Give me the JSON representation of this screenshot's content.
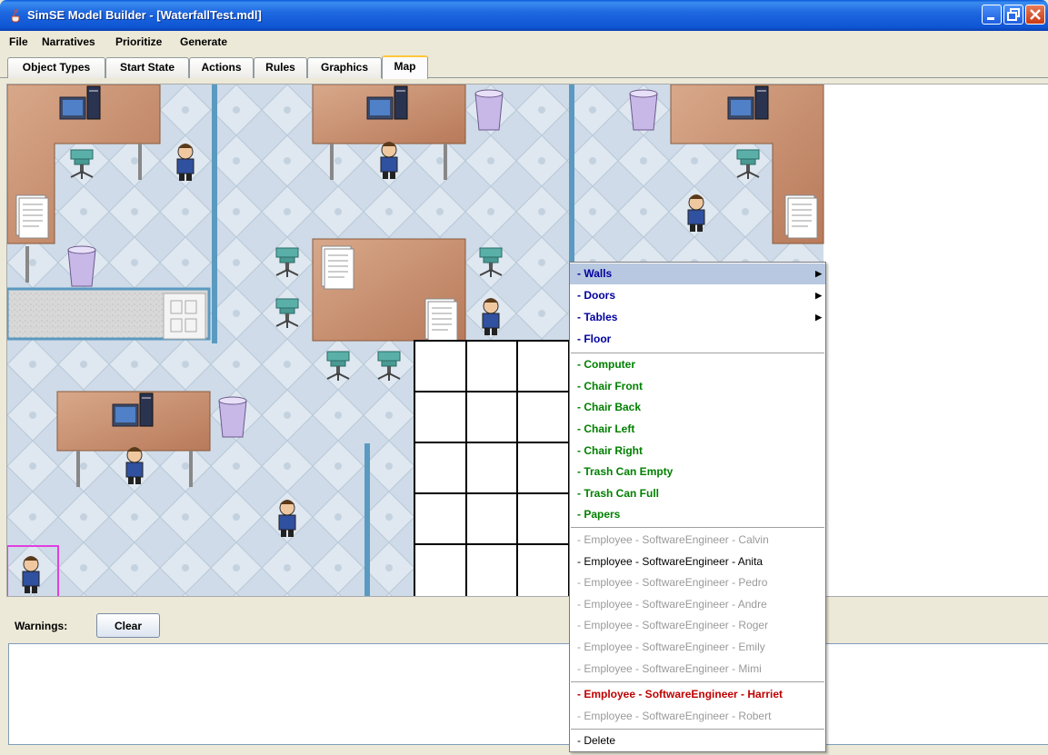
{
  "window": {
    "title": "SimSE Model Builder - [WaterfallTest.mdl]"
  },
  "menu": [
    "File",
    "Narratives",
    "Prioritize",
    "Generate"
  ],
  "tabs": [
    "Object Types",
    "Start State",
    "Actions",
    "Rules",
    "Graphics",
    "Map"
  ],
  "active_tab": "Map",
  "bottom": {
    "warnings_label": "Warnings:",
    "clear_label": "Clear"
  },
  "context_menu": {
    "group_tiles": [
      {
        "label": "- Walls",
        "submenu": true,
        "selected": true
      },
      {
        "label": "- Doors",
        "submenu": true
      },
      {
        "label": "- Tables",
        "submenu": true
      },
      {
        "label": "- Floor",
        "submenu": false
      }
    ],
    "group_furniture": [
      "- Computer",
      "- Chair Front",
      "- Chair Back",
      "- Chair Left",
      "- Chair Right",
      "- Trash Can Empty",
      "- Trash Can Full",
      "- Papers"
    ],
    "group_employees": [
      {
        "label": "- Employee - SoftwareEngineer - Calvin",
        "state": "disabled"
      },
      {
        "label": "- Employee - SoftwareEngineer - Anita",
        "state": "enabled"
      },
      {
        "label": "- Employee - SoftwareEngineer - Pedro",
        "state": "disabled"
      },
      {
        "label": "- Employee - SoftwareEngineer - Andre",
        "state": "disabled"
      },
      {
        "label": "- Employee - SoftwareEngineer - Roger",
        "state": "disabled"
      },
      {
        "label": "- Employee - SoftwareEngineer - Emily",
        "state": "disabled"
      },
      {
        "label": "- Employee - SoftwareEngineer - Mimi",
        "state": "disabled"
      }
    ],
    "group_highlight": [
      {
        "label": "- Employee - SoftwareEngineer - Harriet",
        "state": "highlight"
      },
      {
        "label": "- Employee - SoftwareEngineer - Robert",
        "state": "disabled"
      }
    ],
    "delete_label": "- Delete"
  },
  "colors": {
    "titlebar": "#0f55d4",
    "desk": "#c89070",
    "chair": "#5ab0a8",
    "floor": "#d0dce8",
    "walls_blue": "#5a9ac0",
    "menu_selected": "#b8c8e0",
    "employee_highlight": "#c00000",
    "furniture_green": "#008000",
    "tile_blue": "#0000a0"
  }
}
